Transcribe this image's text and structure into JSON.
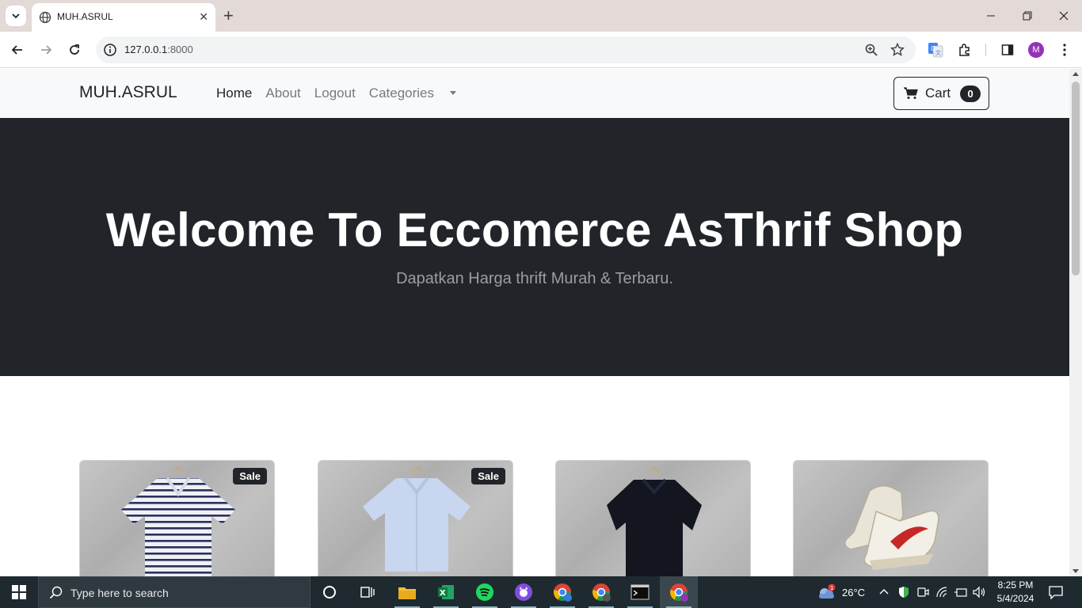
{
  "browser": {
    "tab_title": "MUH.ASRUL",
    "url_host": "127.0.0.1",
    "url_port": ":8000",
    "profile_initial": "M"
  },
  "navbar": {
    "brand": "MUH.ASRUL",
    "links": [
      {
        "label": "Home",
        "active": true
      },
      {
        "label": "About",
        "active": false
      },
      {
        "label": "Logout",
        "active": false
      }
    ],
    "categories_label": "Categories",
    "cart_label": "Cart",
    "cart_count": "0"
  },
  "hero": {
    "title": "Welcome To Eccomerce AsThrif Shop",
    "subtitle": "Dapatkan Harga thrift Murah & Terbaru."
  },
  "products": [
    {
      "badge": "Sale",
      "image": "striped-polo-shirt"
    },
    {
      "badge": "Sale",
      "image": "light-blue-shirt"
    },
    {
      "badge": "",
      "image": "navy-polo-shirt"
    },
    {
      "badge": "",
      "image": "white-high-top-sneakers"
    }
  ],
  "taskbar": {
    "search_placeholder": "Type here to search",
    "weather": "26°C",
    "weather_badge": "1",
    "time": "8:25 PM",
    "date": "5/4/2024"
  },
  "colors": {
    "hero_bg": "#212529",
    "navbar_bg": "#f8f9fa",
    "taskbar_bg": "#1f2a30",
    "accent_red": "#c62828"
  }
}
